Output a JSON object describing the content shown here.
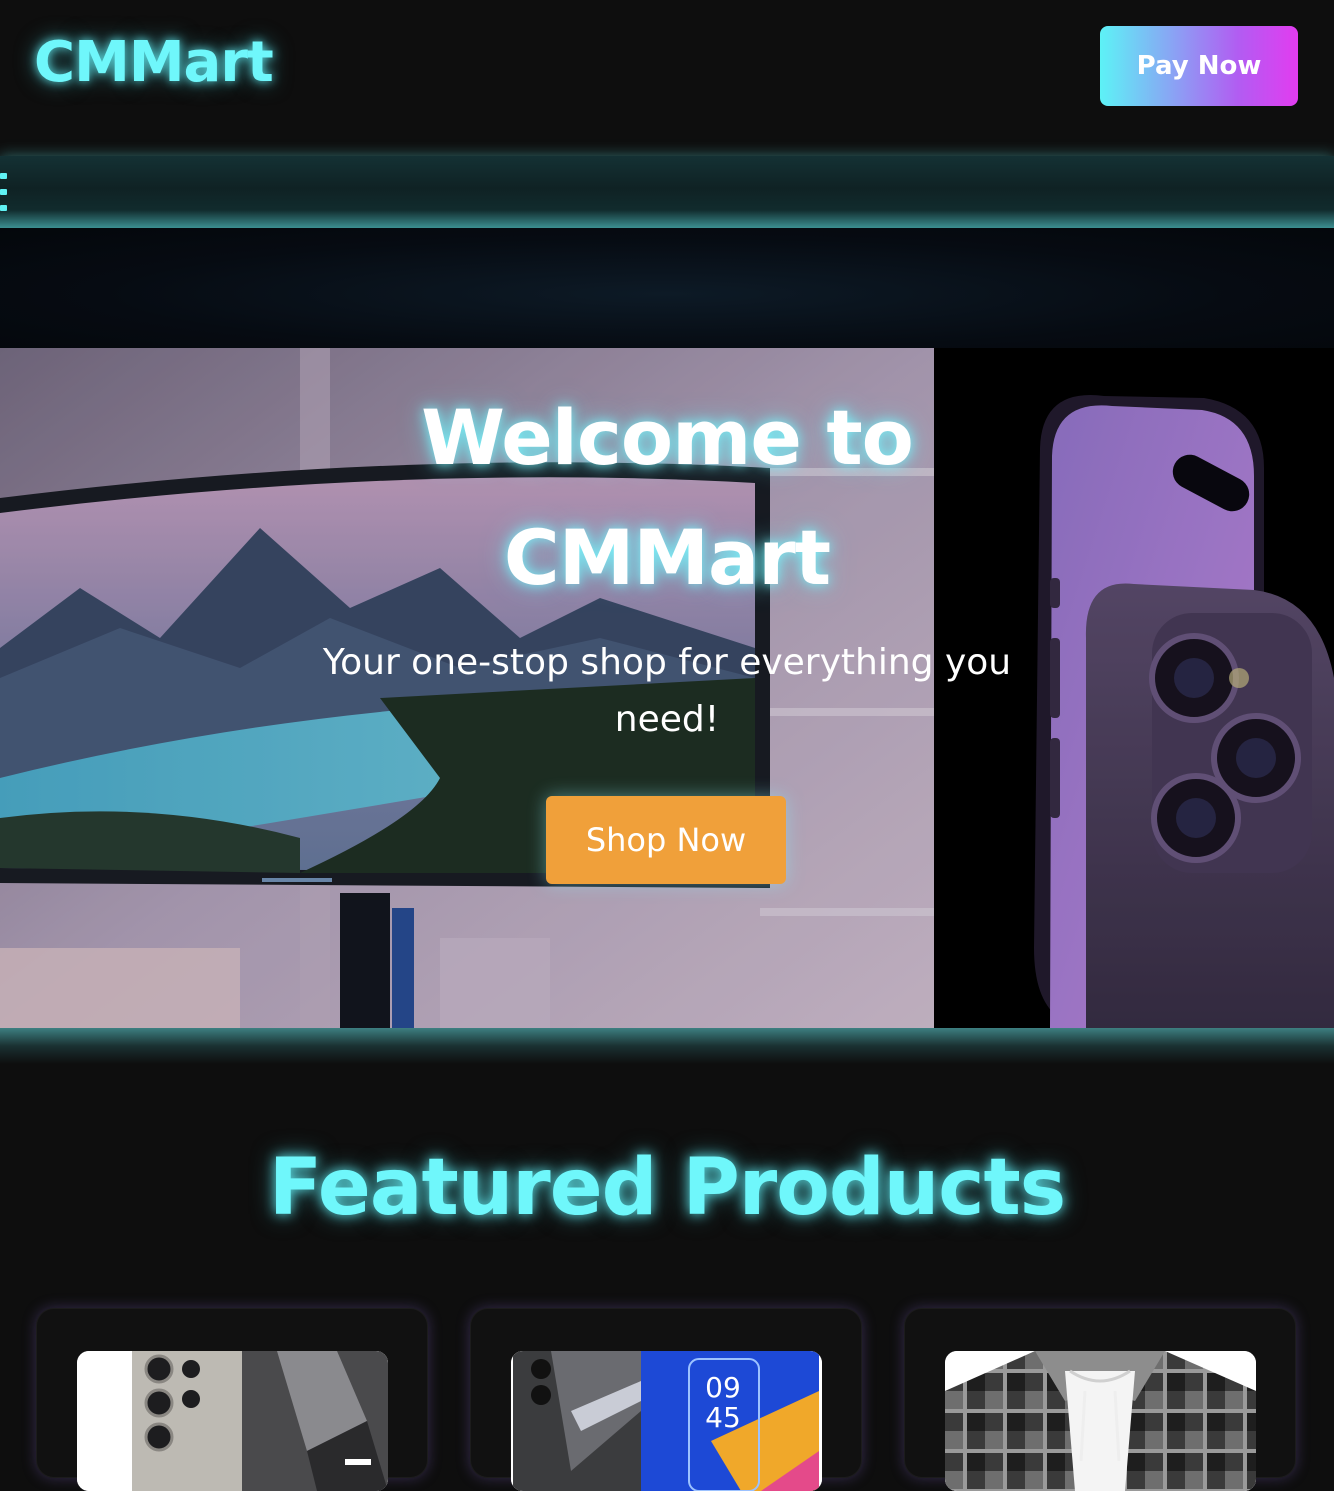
{
  "header": {
    "logo": "CMMart",
    "pay_label": "Pay Now"
  },
  "nav": {
    "menu_icon": "hamburger-menu-icon"
  },
  "hero": {
    "title": "Welcome to CMMart",
    "subtitle": "Your one-stop shop for everything you need!",
    "cta_label": "Shop Now"
  },
  "featured": {
    "title": "Featured Products",
    "products": [
      {
        "image": "samsung-phone-image"
      },
      {
        "image": "smartphone-image"
      },
      {
        "image": "plaid-hoodie-jacket-image"
      }
    ]
  },
  "colors": {
    "accent_cyan": "#6ff7fb",
    "shop_button": "#f0a03a",
    "pay_gradient_start": "#5df2f6",
    "pay_gradient_end": "#e23cf0",
    "background": "#0e0e0e"
  }
}
